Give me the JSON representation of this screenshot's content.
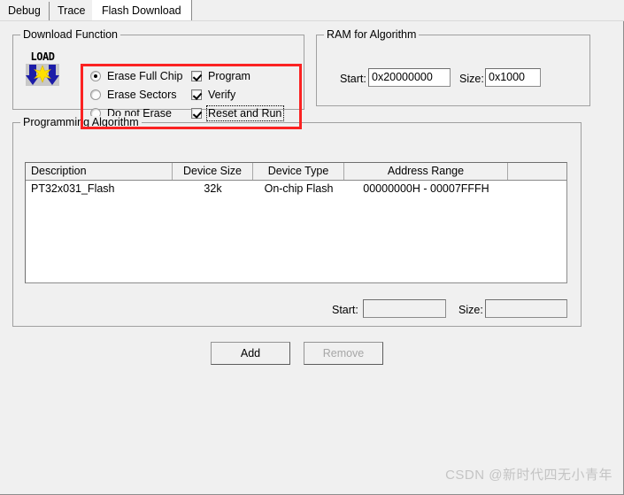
{
  "tabs": [
    {
      "id": "debug",
      "label": "Debug",
      "selected": false
    },
    {
      "id": "trace",
      "label": "Trace",
      "selected": false
    },
    {
      "id": "flash",
      "label": "Flash Download",
      "selected": true
    }
  ],
  "download_function": {
    "title": "Download Function",
    "icon_label": "LOAD",
    "icon_name": "load-flash-icon",
    "erase_options": [
      {
        "label": "Erase Full Chip",
        "selected": true
      },
      {
        "label": "Erase Sectors",
        "selected": false
      },
      {
        "label": "Do not Erase",
        "selected": false
      }
    ],
    "action_options": [
      {
        "label": "Program",
        "checked": true,
        "focused": false
      },
      {
        "label": "Verify",
        "checked": true,
        "focused": false
      },
      {
        "label": "Reset and Run",
        "checked": true,
        "focused": true
      }
    ],
    "highlight_color": "#fb2222"
  },
  "ram_for_algorithm": {
    "title": "RAM for Algorithm",
    "start_label": "Start:",
    "start_value": "0x20000000",
    "size_label": "Size:",
    "size_value": "0x1000"
  },
  "programming_algorithm": {
    "title": "Programming Algorithm",
    "columns": [
      "Description",
      "Device Size",
      "Device Type",
      "Address Range",
      ""
    ],
    "rows": [
      [
        "PT32x031_Flash",
        "32k",
        "On-chip Flash",
        "00000000H - 00007FFFH",
        ""
      ]
    ],
    "start_label": "Start:",
    "start_value": "",
    "size_label": "Size:",
    "size_value": ""
  },
  "buttons": {
    "add": "Add",
    "remove": "Remove"
  },
  "watermark": "CSDN @新时代四无小青年"
}
